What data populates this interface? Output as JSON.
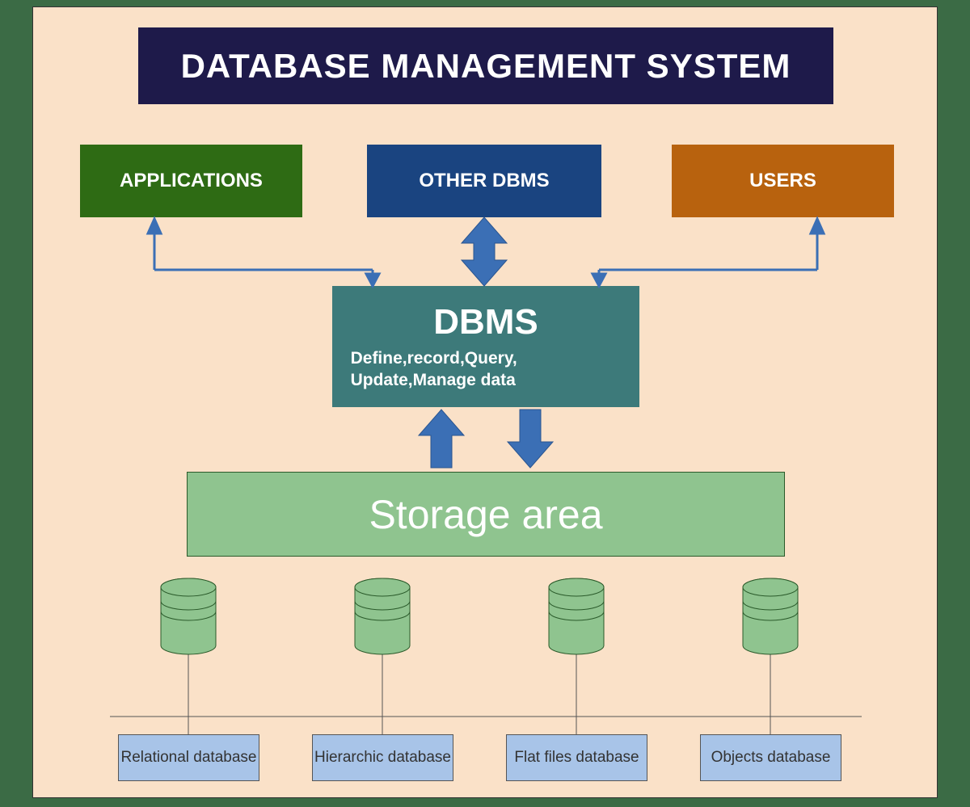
{
  "title": "DATABASE MANAGEMENT SYSTEM",
  "top": {
    "applications": "APPLICATIONS",
    "other_dbms": "OTHER DBMS",
    "users": "USERS"
  },
  "dbms": {
    "title": "DBMS",
    "subtitle1": "Define,record,Query,",
    "subtitle2": "Update,Manage data"
  },
  "storage": "Storage area",
  "databases": {
    "relational": "Relational database",
    "hierarchic": "Hierarchic database",
    "flatfiles": "Flat files database",
    "objects": "Objects database"
  }
}
